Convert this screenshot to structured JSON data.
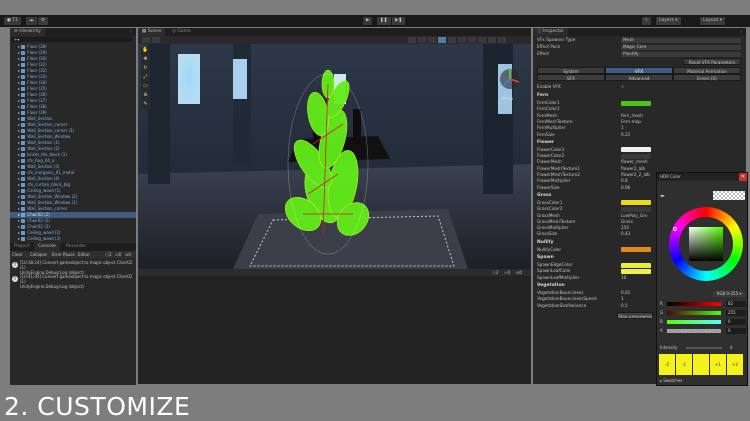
{
  "toolbar": {
    "account_label": "T1",
    "layers_label": "Layers",
    "layout_label": "Layout"
  },
  "hierarchy": {
    "title": "Hierarchy",
    "items": [
      "Floor (28)",
      "Floor (29)",
      "Floor (30)",
      "Floor (31)",
      "Floor (32)",
      "Floor (33)",
      "Floor (34)",
      "Floor (35)",
      "Floor (36)",
      "Floor (37)",
      "Floor (38)",
      "Floor (39)",
      "Wall_Section",
      "Wall_Section_corner",
      "Wall_Section_corner (1)",
      "Wall_Section_Window",
      "Wall_Section (1)",
      "Wall_Section (2)",
      "bricks_tile_block (1)",
      "sfx_Rug_04_a",
      "Wall_Section (3)",
      "sfx_Inorganic_01_metal",
      "Wall_Section (4)",
      "sfx_curtain_block_big",
      "Ceiling_wood (1)",
      "Wall_Section_Window (2)",
      "Wall_Section_Window (1)",
      "Wall_Section_corner",
      "Chair02 (1)",
      "Chair02 (2)",
      "Chair02 (3)",
      "Ceiling_wood (2)",
      "Ceiling_wood (3)"
    ],
    "selected_index": 28
  },
  "console": {
    "tabs": [
      "Project",
      "Console",
      "Recorder"
    ],
    "toolbar_items": [
      "Clear",
      "Collapse",
      "Error Pause",
      "Editor"
    ],
    "counts": [
      "2",
      "0",
      "0"
    ],
    "messages": [
      {
        "time": "[10:38:24]",
        "text": "Convert gameobject to magic object Chair02 (1)",
        "detail": "UnityEngine.Debug:Log (object)"
      },
      {
        "time": "[10:41:04]",
        "text": "Convert gameobject to magic object Chair02 (1)",
        "detail": "UnityEngine.Debug:Log (object)"
      }
    ]
  },
  "scene": {
    "tabs": [
      "Scene",
      "Game"
    ],
    "persp_label": "Persp"
  },
  "inspector": {
    "title": "Inspector",
    "top_fields": [
      {
        "label": "VFx Spawner Type",
        "value": "Mesh"
      },
      {
        "label": "Effect Pack",
        "value": "Magic Core"
      },
      {
        "label": "Effect",
        "value": "Plantify"
      }
    ],
    "reset_button": "Reset VFX Parameters",
    "tabs_row1": [
      "System",
      "VFX",
      "Material Animation"
    ],
    "tabs_row2": [
      "SFX",
      "Advanced",
      "Errors (0)"
    ],
    "enable_vfx_label": "Enable VFX",
    "sections": [
      {
        "title": "Fern",
        "rows": [
          {
            "label": "FernColor1",
            "value": "",
            "color": "#4cc41a"
          },
          {
            "label": "FernColor2",
            "value": "",
            "color": "#2a2a2a"
          },
          {
            "label": "FernMesh",
            "value": "fern_mesh"
          },
          {
            "label": "FernMeshTexture",
            "value": "Fern-map"
          },
          {
            "label": "FernMultiplier",
            "value": "1"
          },
          {
            "label": "FernSize",
            "value": "0.21"
          }
        ]
      },
      {
        "title": "Flower",
        "rows": [
          {
            "label": "FlowerColor1",
            "value": "",
            "color": "#f0f0f0"
          },
          {
            "label": "FlowerColor2",
            "value": "",
            "color": "#3a3a3a"
          },
          {
            "label": "FlowerMesh",
            "value": "flower_mesh"
          },
          {
            "label": "FlowerMeshTexture1",
            "value": "flower2_alb"
          },
          {
            "label": "FlowerMeshTexture2",
            "value": "flower2_2_alb"
          },
          {
            "label": "FlowerMultiplier",
            "value": "0.8"
          },
          {
            "label": "FlowerSize",
            "value": "0.06"
          }
        ]
      },
      {
        "title": "Grass",
        "rows": [
          {
            "label": "GrassColor1",
            "value": "",
            "color": "#e7d91c"
          },
          {
            "label": "GrassColor2",
            "value": "",
            "color": "#3a3a3a"
          },
          {
            "label": "GrassMesh",
            "value": "LowPoly_Gre"
          },
          {
            "label": "GrassMeshTexture",
            "value": "Grass"
          },
          {
            "label": "GrassMultiplier",
            "value": "250"
          },
          {
            "label": "GrassSize",
            "value": "0.43"
          }
        ]
      },
      {
        "title": "Nullify",
        "rows": [
          {
            "label": "NullifyColor",
            "value": "",
            "color": "#e08a18"
          }
        ]
      },
      {
        "title": "Spawn",
        "rows": [
          {
            "label": "SpawnEdgeColor",
            "value": "",
            "color": "#e8f030"
          },
          {
            "label": "SpawnLeafColor",
            "value": "",
            "color": "#f0f04a"
          },
          {
            "label": "SpawnLeafMultiplier",
            "value": "10"
          }
        ]
      },
      {
        "title": "Vegetation",
        "rows": [
          {
            "label": "VegetationBounciness",
            "value": "0.01"
          },
          {
            "label": "VegetationBouncinessSpeed",
            "value": "1"
          },
          {
            "label": "VegetationSizeVariance",
            "value": "0.5"
          }
        ]
      }
    ],
    "stop_button": "Stop previewing VFX"
  },
  "picker": {
    "title": "HDR Color",
    "mode": "RGB 0-255",
    "channels": [
      {
        "label": "R",
        "value": "82"
      },
      {
        "label": "G",
        "value": "255"
      },
      {
        "label": "B",
        "value": "0"
      },
      {
        "label": "A",
        "value": "0"
      }
    ],
    "intensity_label": "Intensity",
    "intensity_value": "4",
    "swatch_labels": [
      "-2",
      "-1",
      "",
      "+1",
      "+2"
    ],
    "swatches_label": "Swatches"
  },
  "caption": "2. CUSTOMIZE",
  "colors": {
    "accent": "#3b5e87",
    "fern": "#4cc41a",
    "highlight_yellow": "#f4f21a"
  }
}
